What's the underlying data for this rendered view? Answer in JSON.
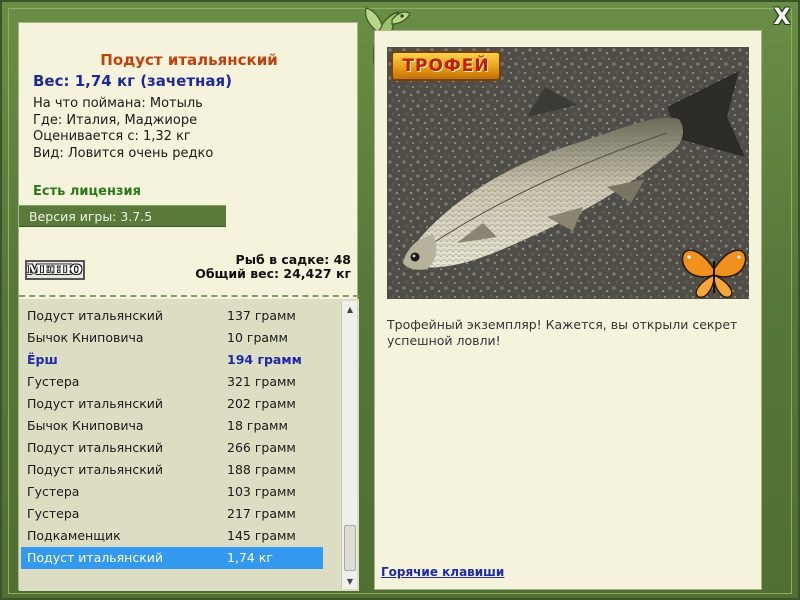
{
  "window": {
    "close_label": "X"
  },
  "fish_info": {
    "title": "Подуст итальянский",
    "weight_line": "Вес: 1,74 кг (зачетная)",
    "bait_line": "На что поймана: Мотыль",
    "location_line": "Где: Италия, Маджиоре",
    "rated_line": "Оценивается с: 1,32 кг",
    "rarity_line": "Вид: Ловится очень редко"
  },
  "license": {
    "label": "Есть лицензия"
  },
  "version": {
    "label": "Версия игры: 3.7.5"
  },
  "menu": {
    "label": "МЕНЮ"
  },
  "catch_stats": {
    "fish_count_line": "Рыб в садке: 48",
    "total_weight_line": "Общий вес: 24,427 кг"
  },
  "catch_list": [
    {
      "name": "Подуст итальянский",
      "weight": "137 грамм",
      "state": "normal"
    },
    {
      "name": "Бычок Книповича",
      "weight": "10 грамм",
      "state": "normal"
    },
    {
      "name": "Ёрш",
      "weight": "194 грамм",
      "state": "highlight"
    },
    {
      "name": "Густера",
      "weight": "321 грамм",
      "state": "normal"
    },
    {
      "name": "Подуст итальянский",
      "weight": "202 грамм",
      "state": "normal"
    },
    {
      "name": "Бычок Книповича",
      "weight": "18 грамм",
      "state": "normal"
    },
    {
      "name": "Подуст итальянский",
      "weight": "266 грамм",
      "state": "normal"
    },
    {
      "name": "Подуст итальянский",
      "weight": "188 грамм",
      "state": "normal"
    },
    {
      "name": "Густера",
      "weight": "103 грамм",
      "state": "normal"
    },
    {
      "name": "Густера",
      "weight": "217 грамм",
      "state": "normal"
    },
    {
      "name": "Подкаменщик",
      "weight": "145 грамм",
      "state": "normal"
    },
    {
      "name": "Подуст итальянский",
      "weight": "1,74 кг",
      "state": "selected"
    }
  ],
  "trophy": {
    "badge_label": "ТРОФЕЙ",
    "description": "Трофейный экземпляр! Кажется, вы открыли секрет успешной ловли!"
  },
  "footer": {
    "hotkeys_label": "Горячие клавиши"
  },
  "colors": {
    "frame_green": "#5d7f3c",
    "panel_cream": "#f6f3dc",
    "title_orange": "#c0410e",
    "weight_blue": "#1e2a96",
    "license_green": "#2b7a1a",
    "selected_blue": "#3399ee"
  }
}
